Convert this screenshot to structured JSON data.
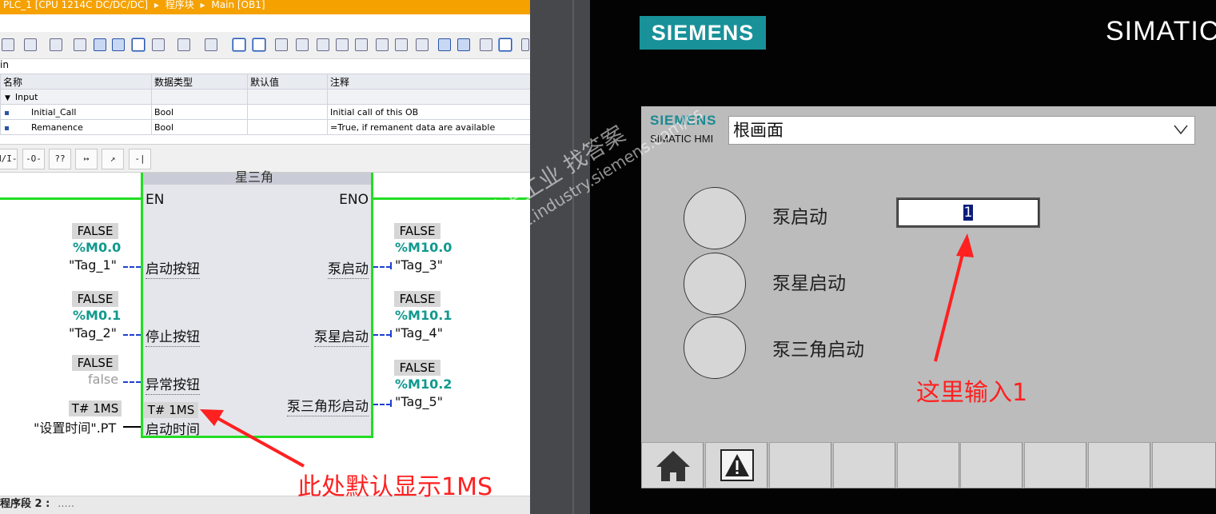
{
  "tia": {
    "breadcrumb": [
      "PLC_1 [CPU 1214C DC/DC/DC]",
      "▸",
      "程序块",
      "▸",
      "Main [OB1]"
    ],
    "block_label": "in",
    "interface": {
      "headers": [
        "名称",
        "数据类型",
        "默认值",
        "注释"
      ],
      "group": "Input",
      "rows": [
        {
          "name": "Initial_Call",
          "type": "Bool",
          "default": "",
          "comment": "Initial call of this OB"
        },
        {
          "name": "Remanence",
          "type": "Bool",
          "default": "",
          "comment": "=True, if remanent data are available"
        }
      ]
    },
    "ladder_toolbar": [
      "H/I-",
      "-O-",
      "??",
      "↦",
      "↗",
      "-|"
    ],
    "fb": {
      "title": "星三角",
      "en": "EN",
      "eno": "ENO",
      "inputs": [
        {
          "value": "FALSE",
          "address": "%M0.0",
          "tag": "\"Tag_1\"",
          "pin": "启动按钮"
        },
        {
          "value": "FALSE",
          "address": "%M0.1",
          "tag": "\"Tag_2\"",
          "pin": "停止按钮"
        },
        {
          "value": "FALSE",
          "address": "false",
          "tag": "",
          "pin": "异常按钮"
        },
        {
          "value": "T# 1MS",
          "address": "",
          "tag": "\"设置时间\".PT",
          "pin": "启动时间",
          "inner_value": "T# 1MS"
        }
      ],
      "outputs": [
        {
          "value": "FALSE",
          "address": "%M10.0",
          "tag": "\"Tag_3\"",
          "pin": "泵启动"
        },
        {
          "value": "FALSE",
          "address": "%M10.1",
          "tag": "\"Tag_4\"",
          "pin": "泵星启动"
        },
        {
          "value": "FALSE",
          "address": "%M10.2",
          "tag": "\"Tag_5\"",
          "pin": "泵三角形启动"
        }
      ]
    },
    "network2_label": "程序段 2 :",
    "network2_comment": "....."
  },
  "hmi": {
    "brand_logo": "SIEMENS",
    "panel_title": "SIMATIC",
    "screen_brand": "SIEMENS",
    "screen_brand_sub": "SIMATIC HMI",
    "screen_select": "根画面",
    "lamps": [
      "泵启动",
      "泵星启动",
      "泵三角启动"
    ],
    "io_value": "1",
    "function_keys": [
      "home-icon",
      "alarm-icon",
      "",
      "",
      "",
      "",
      "",
      "",
      ""
    ]
  },
  "annotations": {
    "left": "此处默认显示1MS",
    "right": "这里输入1"
  },
  "watermark": {
    "line1": "西门子工业 找答案",
    "line2": "support.industry.siemens.com/cs"
  },
  "colors": {
    "tia_title": "#f5a100",
    "rail": "#22dd22",
    "address": "#11998e",
    "siemens_teal": "#199199",
    "annotation": "#ff2020"
  }
}
